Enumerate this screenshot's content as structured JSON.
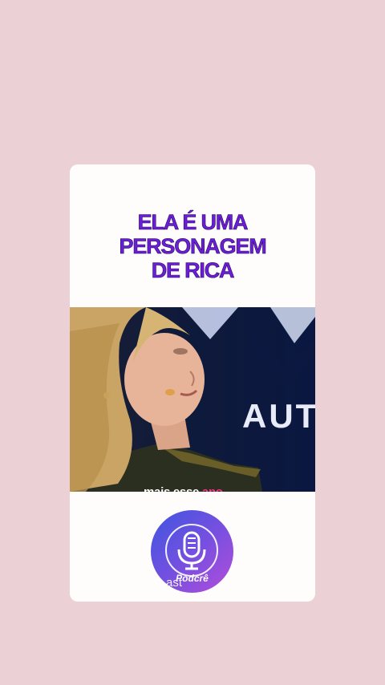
{
  "headline": {
    "line1": "ELA É UMA",
    "line2": "PERSONAGEM",
    "line3": "DE RICA"
  },
  "video": {
    "background_text": "AUTO",
    "subtitle_white": "mais esse",
    "subtitle_pink": "ano"
  },
  "logo": {
    "icon": "microphone-icon",
    "label": "Podcrê",
    "suffix": "ast"
  },
  "colors": {
    "page_background": "#ebd1d6",
    "headline": "#6a1fd6",
    "subtitle_highlight": "#ff2f8e"
  }
}
